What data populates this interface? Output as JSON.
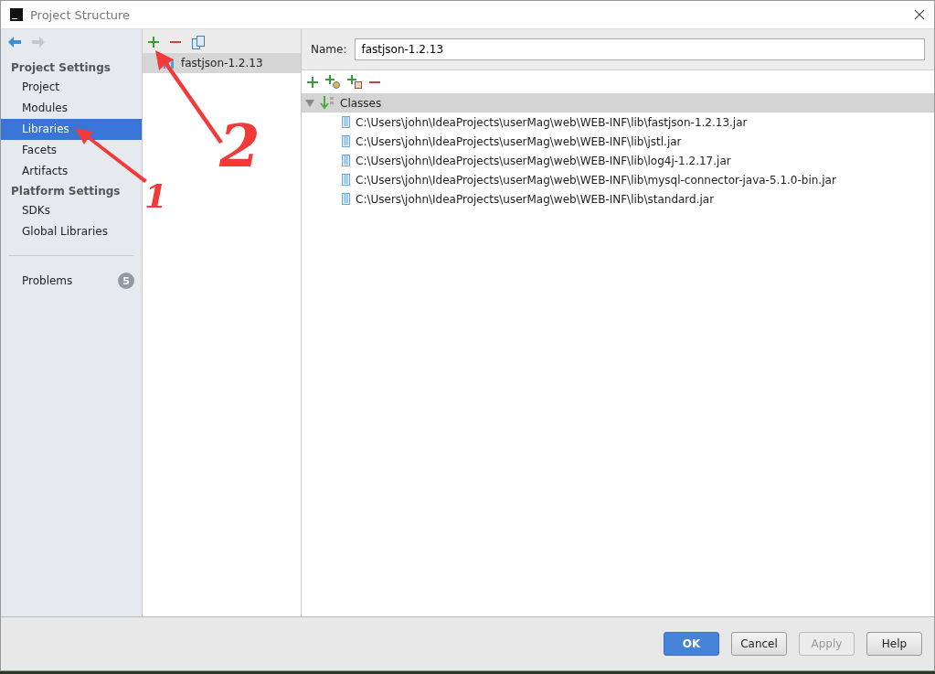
{
  "window": {
    "title": "Project Structure"
  },
  "sidebar": {
    "sections": [
      {
        "heading": "Project Settings",
        "items": [
          {
            "label": "Project",
            "selected": false
          },
          {
            "label": "Modules",
            "selected": false
          },
          {
            "label": "Libraries",
            "selected": true
          },
          {
            "label": "Facets",
            "selected": false
          },
          {
            "label": "Artifacts",
            "selected": false
          }
        ]
      },
      {
        "heading": "Platform Settings",
        "items": [
          {
            "label": "SDKs",
            "selected": false
          },
          {
            "label": "Global Libraries",
            "selected": false
          }
        ]
      }
    ],
    "problems": {
      "label": "Problems",
      "count": "5"
    }
  },
  "libraries": [
    {
      "label": "fastjson-1.2.13",
      "selected": true
    }
  ],
  "details": {
    "name_label": "Name:",
    "name_value": "fastjson-1.2.13",
    "tree": {
      "label": "Classes",
      "expanded": true,
      "children": [
        {
          "label": "C:\\Users\\john\\IdeaProjects\\userMag\\web\\WEB-INF\\lib\\fastjson-1.2.13.jar"
        },
        {
          "label": "C:\\Users\\john\\IdeaProjects\\userMag\\web\\WEB-INF\\lib\\jstl.jar"
        },
        {
          "label": "C:\\Users\\john\\IdeaProjects\\userMag\\web\\WEB-INF\\lib\\log4j-1.2.17.jar"
        },
        {
          "label": "C:\\Users\\john\\IdeaProjects\\userMag\\web\\WEB-INF\\lib\\mysql-connector-java-5.1.0-bin.jar"
        },
        {
          "label": "C:\\Users\\john\\IdeaProjects\\userMag\\web\\WEB-INF\\lib\\standard.jar"
        }
      ]
    }
  },
  "buttons": [
    {
      "label": "OK",
      "kind": "primary",
      "disabled": false
    },
    {
      "label": "Cancel",
      "kind": "normal",
      "disabled": false
    },
    {
      "label": "Apply",
      "kind": "normal",
      "disabled": true
    },
    {
      "label": "Help",
      "kind": "normal",
      "disabled": false
    }
  ],
  "annotations": [
    {
      "label": "1"
    },
    {
      "label": "2"
    }
  ]
}
